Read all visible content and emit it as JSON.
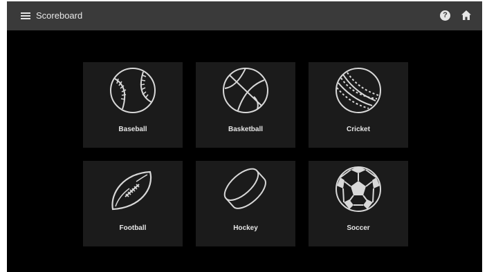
{
  "app": {
    "title": "Scoreboard",
    "colors": {
      "topbar": "#3a3a3a",
      "background": "#000000",
      "tile": "#1b1b1b",
      "text": "#e6e6e6"
    }
  },
  "topbar": {
    "menu_icon": "hamburger-menu-icon",
    "help_icon": "help-circle-icon",
    "help_glyph": "?",
    "home_icon": "home-icon"
  },
  "sports": [
    {
      "label": "Baseball",
      "icon": "baseball-icon"
    },
    {
      "label": "Basketball",
      "icon": "basketball-icon"
    },
    {
      "label": "Cricket",
      "icon": "cricket-ball-icon"
    },
    {
      "label": "Football",
      "icon": "football-icon"
    },
    {
      "label": "Hockey",
      "icon": "hockey-puck-icon"
    },
    {
      "label": "Soccer",
      "icon": "soccer-ball-icon"
    }
  ]
}
